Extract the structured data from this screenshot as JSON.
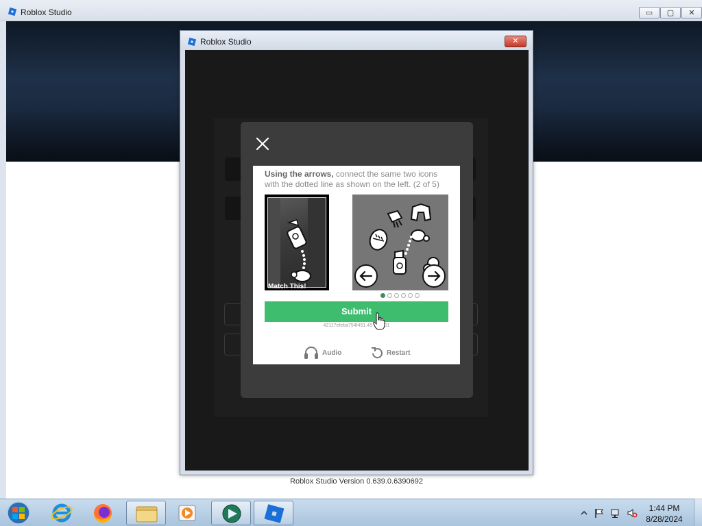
{
  "main_window": {
    "title": "Roblox Studio",
    "controls": {
      "minimize": "▭",
      "maximize": "▢",
      "close": "✕"
    },
    "version_text": "Roblox Studio Version 0.639.0.6390692"
  },
  "dialog": {
    "title": "Roblox Studio",
    "close_glyph": "✕"
  },
  "captcha": {
    "instructions_bold": "Using the arrows,",
    "instructions_rest": " connect the same two icons with the dotted line as shown on the left. (2 of 5)",
    "example_label": "Match This!",
    "page_count": 6,
    "active_page": 1,
    "submit_label": "Submit",
    "session_id": "42117efeba754f451.45       4401",
    "audio_label": "Audio",
    "restart_label": "Restart",
    "colors": {
      "submit": "#3fbd6f",
      "active_dot": "#3c8f5c"
    },
    "icons": {
      "close": "close-icon",
      "left_arrow": "arrow-left-icon",
      "right_arrow": "arrow-right-icon",
      "audio": "headphones-icon",
      "restart": "restart-icon"
    }
  },
  "taskbar": {
    "items": [
      "start",
      "internet-explorer",
      "firefox",
      "file-explorer",
      "media-player",
      "roblox-player",
      "roblox-studio"
    ],
    "clock_time": "1:44 PM",
    "clock_date": "8/28/2024",
    "tray_icons": [
      "show-hidden-icons",
      "action-center-flag",
      "network",
      "volume-muted"
    ]
  }
}
